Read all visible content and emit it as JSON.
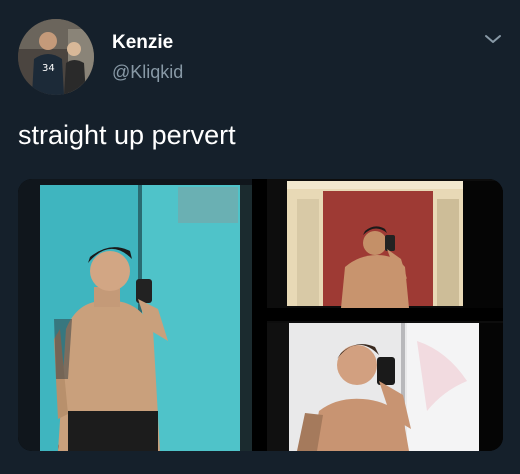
{
  "tweet": {
    "author": {
      "display_name": "Kenzie",
      "handle": "@Kliqkid",
      "avatar_icon": "profile-photo"
    },
    "text": "straight up pervert",
    "menu_icon": "chevron-down-icon",
    "media": [
      {
        "label": "photo-1"
      },
      {
        "label": "photo-2"
      },
      {
        "label": "photo-3"
      }
    ]
  },
  "theme": {
    "background": "#15202b",
    "primary_text": "#ffffff",
    "secondary_text": "#8899a6"
  }
}
